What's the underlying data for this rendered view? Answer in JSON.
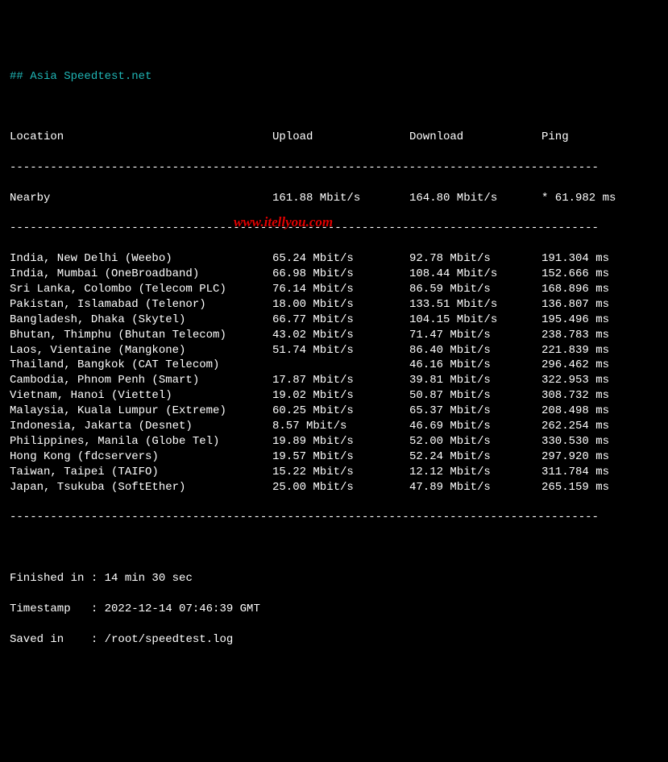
{
  "title": "## Asia Speedtest.net",
  "headers": {
    "location": "Location",
    "upload": "Upload",
    "download": "Download",
    "ping": "Ping"
  },
  "nearby": {
    "location": "Nearby",
    "upload": "161.88 Mbit/s",
    "download": "164.80 Mbit/s",
    "ping": "* 61.982 ms"
  },
  "rows": [
    {
      "location": "India, New Delhi (Weebo)",
      "upload": "65.24 Mbit/s",
      "download": "92.78 Mbit/s",
      "ping": "191.304 ms"
    },
    {
      "location": "India, Mumbai (OneBroadband)",
      "upload": "66.98 Mbit/s",
      "download": "108.44 Mbit/s",
      "ping": "152.666 ms"
    },
    {
      "location": "Sri Lanka, Colombo (Telecom PLC)",
      "upload": "76.14 Mbit/s",
      "download": "86.59 Mbit/s",
      "ping": "168.896 ms"
    },
    {
      "location": "Pakistan, Islamabad (Telenor)",
      "upload": "18.00 Mbit/s",
      "download": "133.51 Mbit/s",
      "ping": "136.807 ms"
    },
    {
      "location": "Bangladesh, Dhaka (Skytel)",
      "upload": "66.77 Mbit/s",
      "download": "104.15 Mbit/s",
      "ping": "195.496 ms"
    },
    {
      "location": "Bhutan, Thimphu (Bhutan Telecom)",
      "upload": "43.02 Mbit/s",
      "download": "71.47 Mbit/s",
      "ping": "238.783 ms"
    },
    {
      "location": "Laos, Vientaine (Mangkone)",
      "upload": "51.74 Mbit/s",
      "download": "86.40 Mbit/s",
      "ping": "221.839 ms"
    },
    {
      "location": "Thailand, Bangkok (CAT Telecom)",
      "upload": "",
      "download": "46.16 Mbit/s",
      "ping": "296.462 ms"
    },
    {
      "location": "Cambodia, Phnom Penh (Smart)",
      "upload": "17.87 Mbit/s",
      "download": "39.81 Mbit/s",
      "ping": "322.953 ms"
    },
    {
      "location": "Vietnam, Hanoi (Viettel)",
      "upload": "19.02 Mbit/s",
      "download": "50.87 Mbit/s",
      "ping": "308.732 ms"
    },
    {
      "location": "Malaysia, Kuala Lumpur (Extreme)",
      "upload": "60.25 Mbit/s",
      "download": "65.37 Mbit/s",
      "ping": "208.498 ms"
    },
    {
      "location": "Indonesia, Jakarta (Desnet)",
      "upload": "8.57 Mbit/s",
      "download": "46.69 Mbit/s",
      "ping": "262.254 ms"
    },
    {
      "location": "Philippines, Manila (Globe Tel)",
      "upload": "19.89 Mbit/s",
      "download": "52.00 Mbit/s",
      "ping": "330.530 ms"
    },
    {
      "location": "Hong Kong (fdcservers)",
      "upload": "19.57 Mbit/s",
      "download": "52.24 Mbit/s",
      "ping": "297.920 ms"
    },
    {
      "location": "Taiwan, Taipei (TAIFO)",
      "upload": "15.22 Mbit/s",
      "download": "12.12 Mbit/s",
      "ping": "311.784 ms"
    },
    {
      "location": "Japan, Tsukuba (SoftEther)",
      "upload": "25.00 Mbit/s",
      "download": "47.89 Mbit/s",
      "ping": "265.159 ms"
    }
  ],
  "footer": {
    "finished_label": "Finished in :",
    "finished_value": "14 min 30 sec",
    "timestamp_label": "Timestamp   :",
    "timestamp_value": "2022-12-14 07:46:39 GMT",
    "saved_label": "Saved in    :",
    "saved_value": "/root/speedtest.log"
  },
  "watermark": "www.itellyou.com",
  "sep": "---------------------------------------------------------------------------------------"
}
